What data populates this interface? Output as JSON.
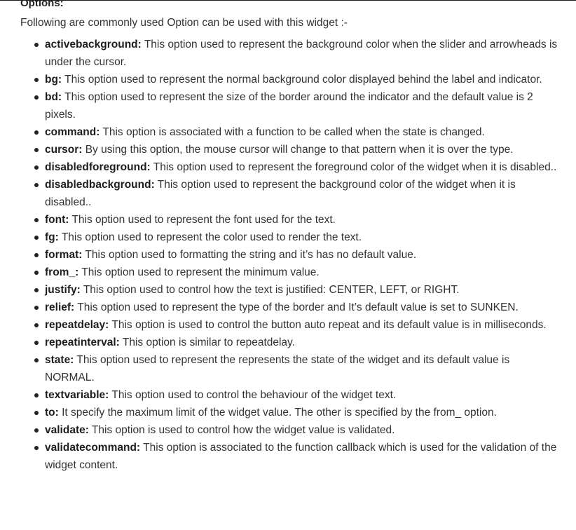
{
  "heading": "Options:",
  "intro": "Following are commonly used Option can be used with this widget :-",
  "options": [
    {
      "term": "activebackground:",
      "desc": " This option used to represent the background color when the slider and arrowheads is under the cursor."
    },
    {
      "term": "bg:",
      "desc": " This option used to represent the normal background color displayed behind the label and indicator."
    },
    {
      "term": "bd:",
      "desc": " This option used to represent the size of the border around the indicator and the default value is 2 pixels."
    },
    {
      "term": "command:",
      "desc": " This option is associated with a function to be called when the state is changed."
    },
    {
      "term": "cursor:",
      "desc": " By using this option, the mouse cursor will change to that pattern when it is over the type."
    },
    {
      "term": "disabledforeground:",
      "desc": " This option used to represent the foreground color of the widget when it is disabled.."
    },
    {
      "term": "disabledbackground:",
      "desc": " This option used to represent the background color of the widget when it is disabled.."
    },
    {
      "term": "font:",
      "desc": " This option used to represent the font used for the text."
    },
    {
      "term": "fg:",
      "desc": " This option used to represent the color used to render the text."
    },
    {
      "term": "format:",
      "desc": " This option used to formatting the string and it’s has no default value."
    },
    {
      "term": "from_:",
      "desc": " This option used to represent the minimum value."
    },
    {
      "term": "justify:",
      "desc": " This option used to control how the text is justified: CENTER, LEFT, or RIGHT."
    },
    {
      "term": "relief:",
      "desc": " This option used to represent the type of the border and It’s default value is set to SUNKEN."
    },
    {
      "term": "repeatdelay:",
      "desc": " This option is used to control the button auto repeat and its default value is in milliseconds."
    },
    {
      "term": "repeatinterval:",
      "desc": " This option is similar to repeatdelay."
    },
    {
      "term": "state:",
      "desc": " This option used to represent the represents the state of the widget and its default value is NORMAL."
    },
    {
      "term": "textvariable:",
      "desc": " This option used to control the behaviour of the widget text."
    },
    {
      "term": "to:",
      "desc": " It specify the maximum limit of the widget value. The other is specified by the from_ option."
    },
    {
      "term": "validate:",
      "desc": " This option is used to control how the widget value is validated."
    },
    {
      "term": "validatecommand:",
      "desc": " This option is associated to the function callback which is used for the validation of the widget content."
    }
  ]
}
